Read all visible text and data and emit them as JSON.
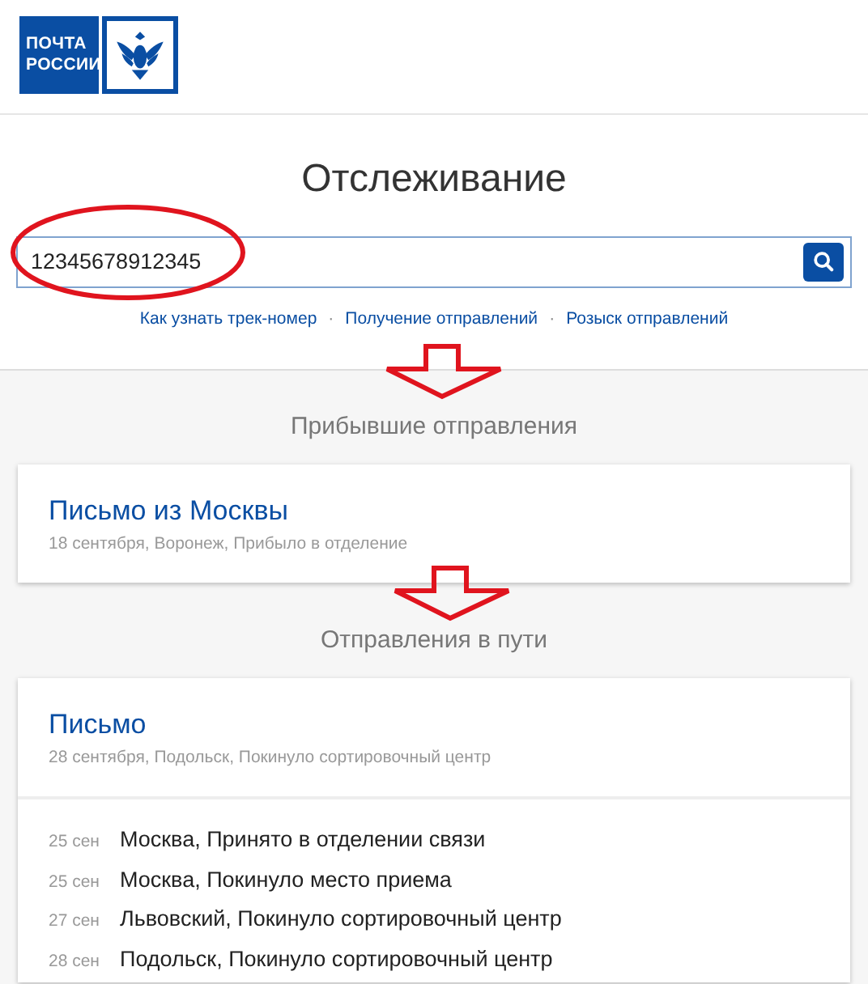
{
  "logo": {
    "lines": [
      "ПОЧТА",
      "РОССИИ"
    ]
  },
  "title": "Отслеживание",
  "search": {
    "value": "12345678912345"
  },
  "links": [
    "Как узнать трек-номер",
    "Получение отправлений",
    "Розыск отправлений"
  ],
  "link_separator": "·",
  "sections": [
    {
      "heading": "Прибывшие отправления",
      "parcels": [
        {
          "title": "Письмо из Москвы",
          "status": "18 сентября, Воронеж, Прибыло в отделение"
        }
      ]
    },
    {
      "heading": "Отправления в пути",
      "parcels": [
        {
          "title": "Письмо",
          "status": "28 сентября, Подольск, Покинуло сортировочный центр",
          "events": [
            {
              "date": "25 сен",
              "text": "Москва, Принято в отделении связи"
            },
            {
              "date": "25 сен",
              "text": "Москва, Покинуло место приема"
            },
            {
              "date": "27 сен",
              "text": "Львовский, Покинуло сортировочный центр"
            },
            {
              "date": "28 сен",
              "text": "Подольск, Покинуло сортировочный центр"
            }
          ]
        }
      ]
    }
  ],
  "annotations": [
    {
      "kind": "ellipse"
    },
    {
      "kind": "arrow"
    },
    {
      "kind": "arrow"
    }
  ]
}
